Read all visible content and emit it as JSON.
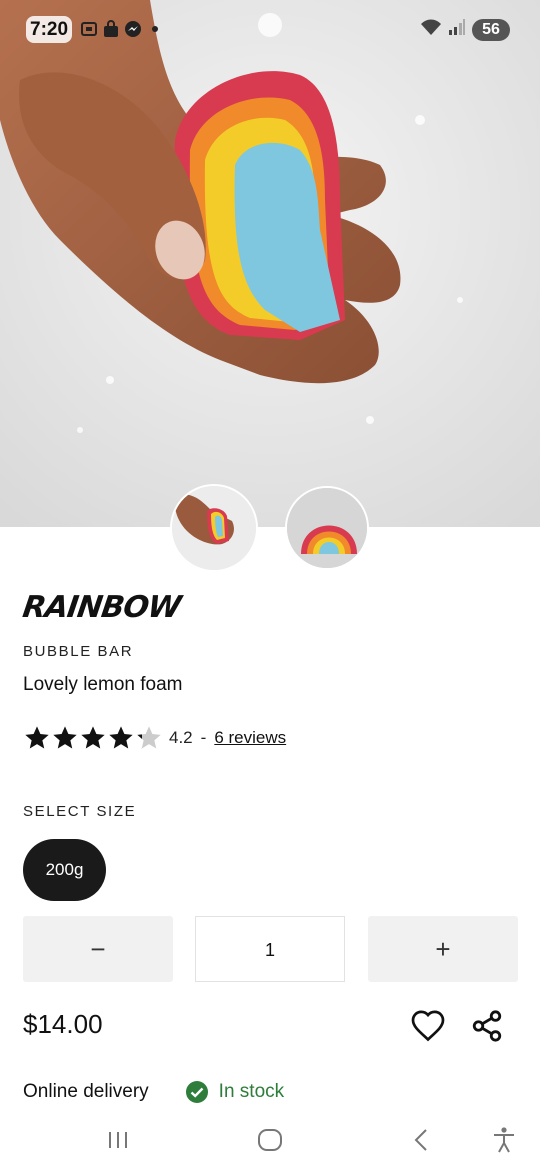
{
  "status_bar": {
    "time": "7:20",
    "battery": "56",
    "icons": [
      "screenshot-icon",
      "bag-icon",
      "messenger-icon",
      "dot-icon",
      "wifi-icon",
      "signal-icon",
      "battery-charging-icon"
    ]
  },
  "product": {
    "name": "RAINBOW",
    "category": "BUBBLE BAR",
    "tagline": "Lovely lemon foam",
    "rating": 4.2,
    "rating_text": "4.2",
    "rating_separator": "-",
    "reviews_link": "6 reviews",
    "stars_filled": 4,
    "stars_total": 5
  },
  "size": {
    "label": "SELECT SIZE",
    "options": [
      "200g"
    ],
    "selected": "200g"
  },
  "quantity": {
    "minus_label": "−",
    "value": "1",
    "plus_label": "+"
  },
  "price": "$14.00",
  "delivery": {
    "label": "Online delivery",
    "stock_status": "In stock"
  },
  "colors": {
    "accent": "#1a1a1a",
    "in_stock": "#2f7d3b",
    "qty_button_bg": "#f1f1f1"
  }
}
